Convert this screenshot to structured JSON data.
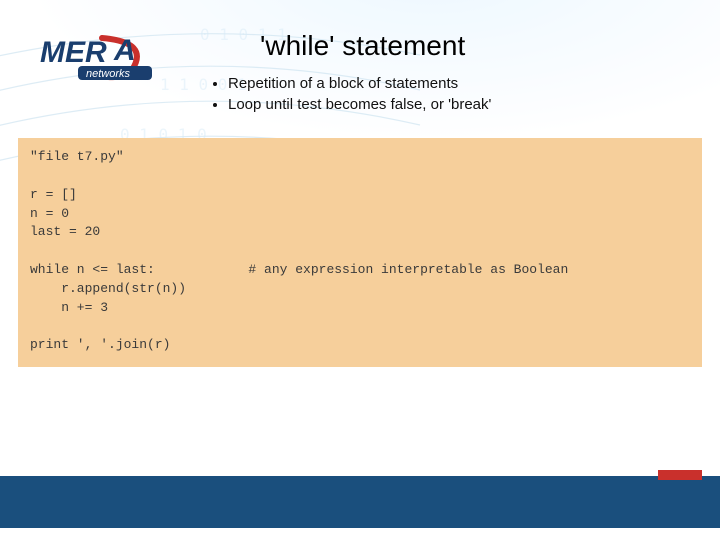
{
  "logo": {
    "brand_main": "MER",
    "brand_sub": "networks"
  },
  "title": "'while' statement",
  "bullets": [
    "Repetition of a block of statements",
    "Loop until test becomes false, or 'break'"
  ],
  "code": "\"file t7.py\"\n\nr = []\nn = 0\nlast = 20\n\nwhile n <= last:            # any expression interpretable as Boolean\n    r.append(str(n))\n    n += 3\n\nprint ', '.join(r)"
}
